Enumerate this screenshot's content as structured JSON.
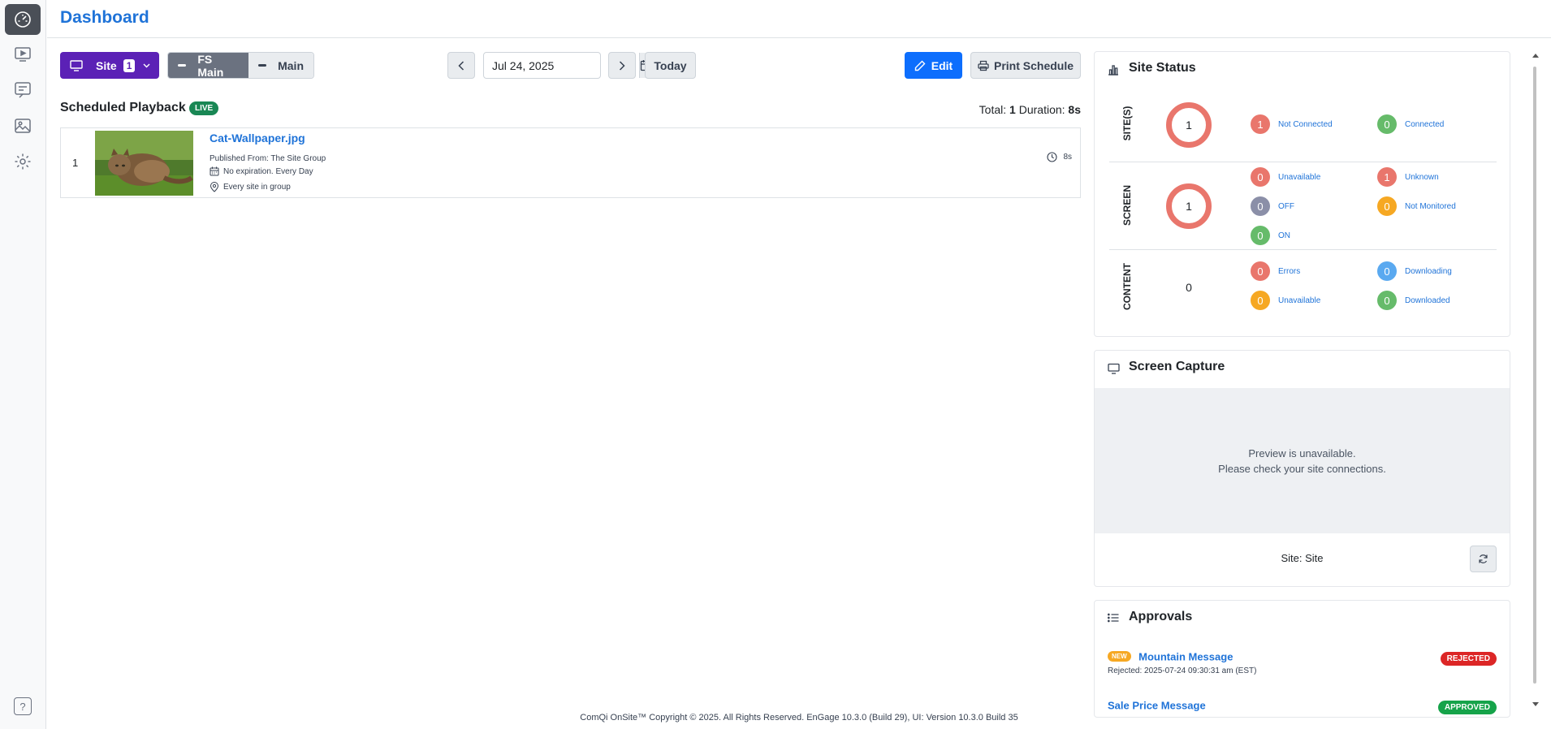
{
  "header": {
    "title": "Dashboard"
  },
  "sidebar": {
    "items": [
      {
        "name": "dashboard-icon",
        "active": true
      },
      {
        "name": "playback-icon"
      },
      {
        "name": "messages-icon"
      },
      {
        "name": "media-icon"
      },
      {
        "name": "settings-icon"
      }
    ],
    "help_label": "?"
  },
  "toolbar": {
    "site_label": "Site",
    "site_count": "1",
    "groups": [
      "FS Main",
      "Main"
    ],
    "date_value": "Jul 24, 2025",
    "today_label": "Today",
    "edit_label": "Edit",
    "print_label": "Print Schedule"
  },
  "playback": {
    "title": "Scheduled Playback",
    "live_label": "LIVE",
    "total_label": "Total:",
    "total_value": "1",
    "duration_label": "Duration:",
    "duration_value": "8s",
    "items": [
      {
        "index": "1",
        "name": "Cat-Wallpaper.jpg",
        "published": "Published From: The Site Group",
        "schedule": "No expiration. Every Day",
        "location": "Every site in group",
        "duration": "8s"
      }
    ]
  },
  "site_status": {
    "title": "Site Status",
    "sites": {
      "label": "SITE(S)",
      "total": "1",
      "stats": [
        {
          "value": "1",
          "label": "Not Connected",
          "color": "#e9766c"
        },
        {
          "value": "0",
          "label": "Connected",
          "color": "#66bb6a"
        }
      ]
    },
    "screen": {
      "label": "SCREEN",
      "total": "1",
      "stats": [
        {
          "value": "0",
          "label": "Unavailable",
          "color": "#e9766c"
        },
        {
          "value": "1",
          "label": "Unknown",
          "color": "#e9766c"
        },
        {
          "value": "0",
          "label": "OFF",
          "color": "#8b8fa8"
        },
        {
          "value": "0",
          "label": "Not Monitored",
          "color": "#f6a823"
        },
        {
          "value": "0",
          "label": "ON",
          "color": "#66bb6a"
        }
      ]
    },
    "content": {
      "label": "CONTENT",
      "total": "0",
      "stats": [
        {
          "value": "0",
          "label": "Errors",
          "color": "#e9766c"
        },
        {
          "value": "0",
          "label": "Downloading",
          "color": "#5aa9f0"
        },
        {
          "value": "0",
          "label": "Unavailable",
          "color": "#f6a823"
        },
        {
          "value": "0",
          "label": "Downloaded",
          "color": "#66bb6a"
        }
      ]
    }
  },
  "screen_capture": {
    "title": "Screen Capture",
    "preview_line1": "Preview is unavailable.",
    "preview_line2": "Please check your site connections.",
    "site_text": "Site: Site"
  },
  "approvals": {
    "title": "Approvals",
    "items": [
      {
        "new_label": "NEW",
        "name": "Mountain Message",
        "sub": "Rejected: 2025-07-24 09:30:31 am (EST)",
        "status": "REJECTED"
      },
      {
        "name": "Sale Price Message",
        "status": "APPROVED"
      }
    ]
  },
  "footer": {
    "text": "ComQi OnSite™ Copyright © 2025. All Rights Reserved. EnGage 10.3.0 (Build 29), UI: Version 10.3.0 Build 35"
  }
}
